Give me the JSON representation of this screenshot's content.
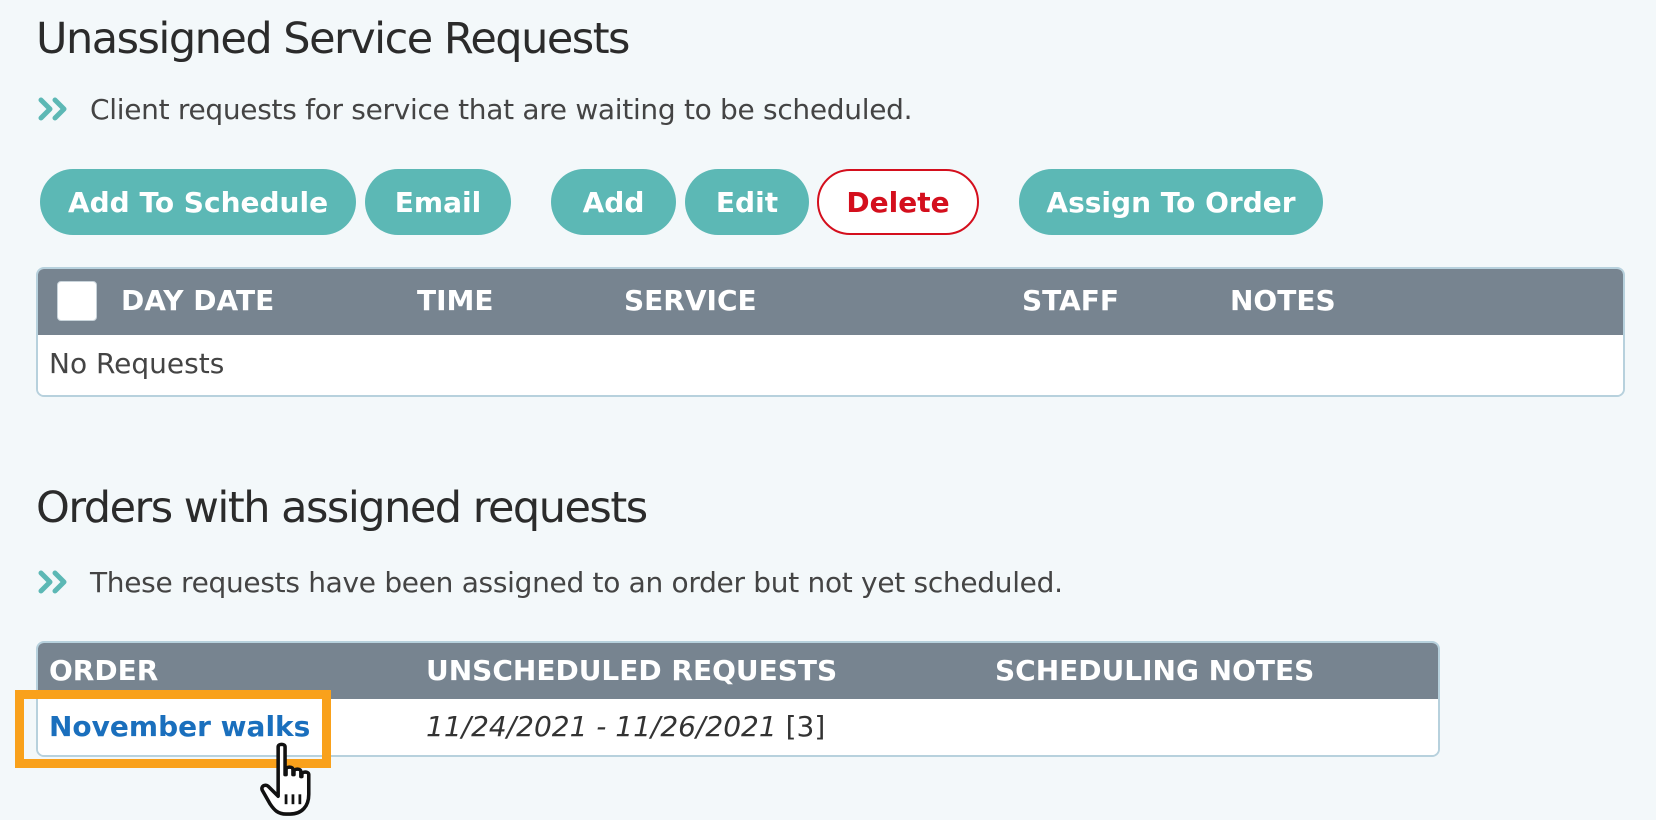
{
  "unassigned": {
    "title": "Unassigned Service Requests",
    "subtitle": "Client requests for service that are waiting to be scheduled.",
    "buttons": {
      "add_to_schedule": "Add To Schedule",
      "email": "Email",
      "add": "Add",
      "edit": "Edit",
      "delete": "Delete",
      "assign_to_order": "Assign To Order"
    },
    "columns": [
      "DAY DATE",
      "TIME",
      "SERVICE",
      "STAFF",
      "NOTES"
    ],
    "empty_text": "No Requests"
  },
  "orders": {
    "title": "Orders with assigned requests",
    "subtitle": "These requests have been assigned to an order but not yet scheduled.",
    "columns": [
      "ORDER",
      "UNSCHEDULED REQUESTS",
      "SCHEDULING NOTES"
    ],
    "rows": [
      {
        "order": "November walks",
        "dates": "11/24/2021 - 11/26/2021",
        "count": "[3]",
        "notes": ""
      }
    ]
  },
  "colors": {
    "accent": "#5cb8b5",
    "header": "#778490",
    "link": "#1a6fbd",
    "danger": "#d40f1d",
    "highlight": "#f9a11b"
  },
  "icons": [
    "double-chevron-right-icon",
    "pointer-hand-cursor-icon"
  ]
}
